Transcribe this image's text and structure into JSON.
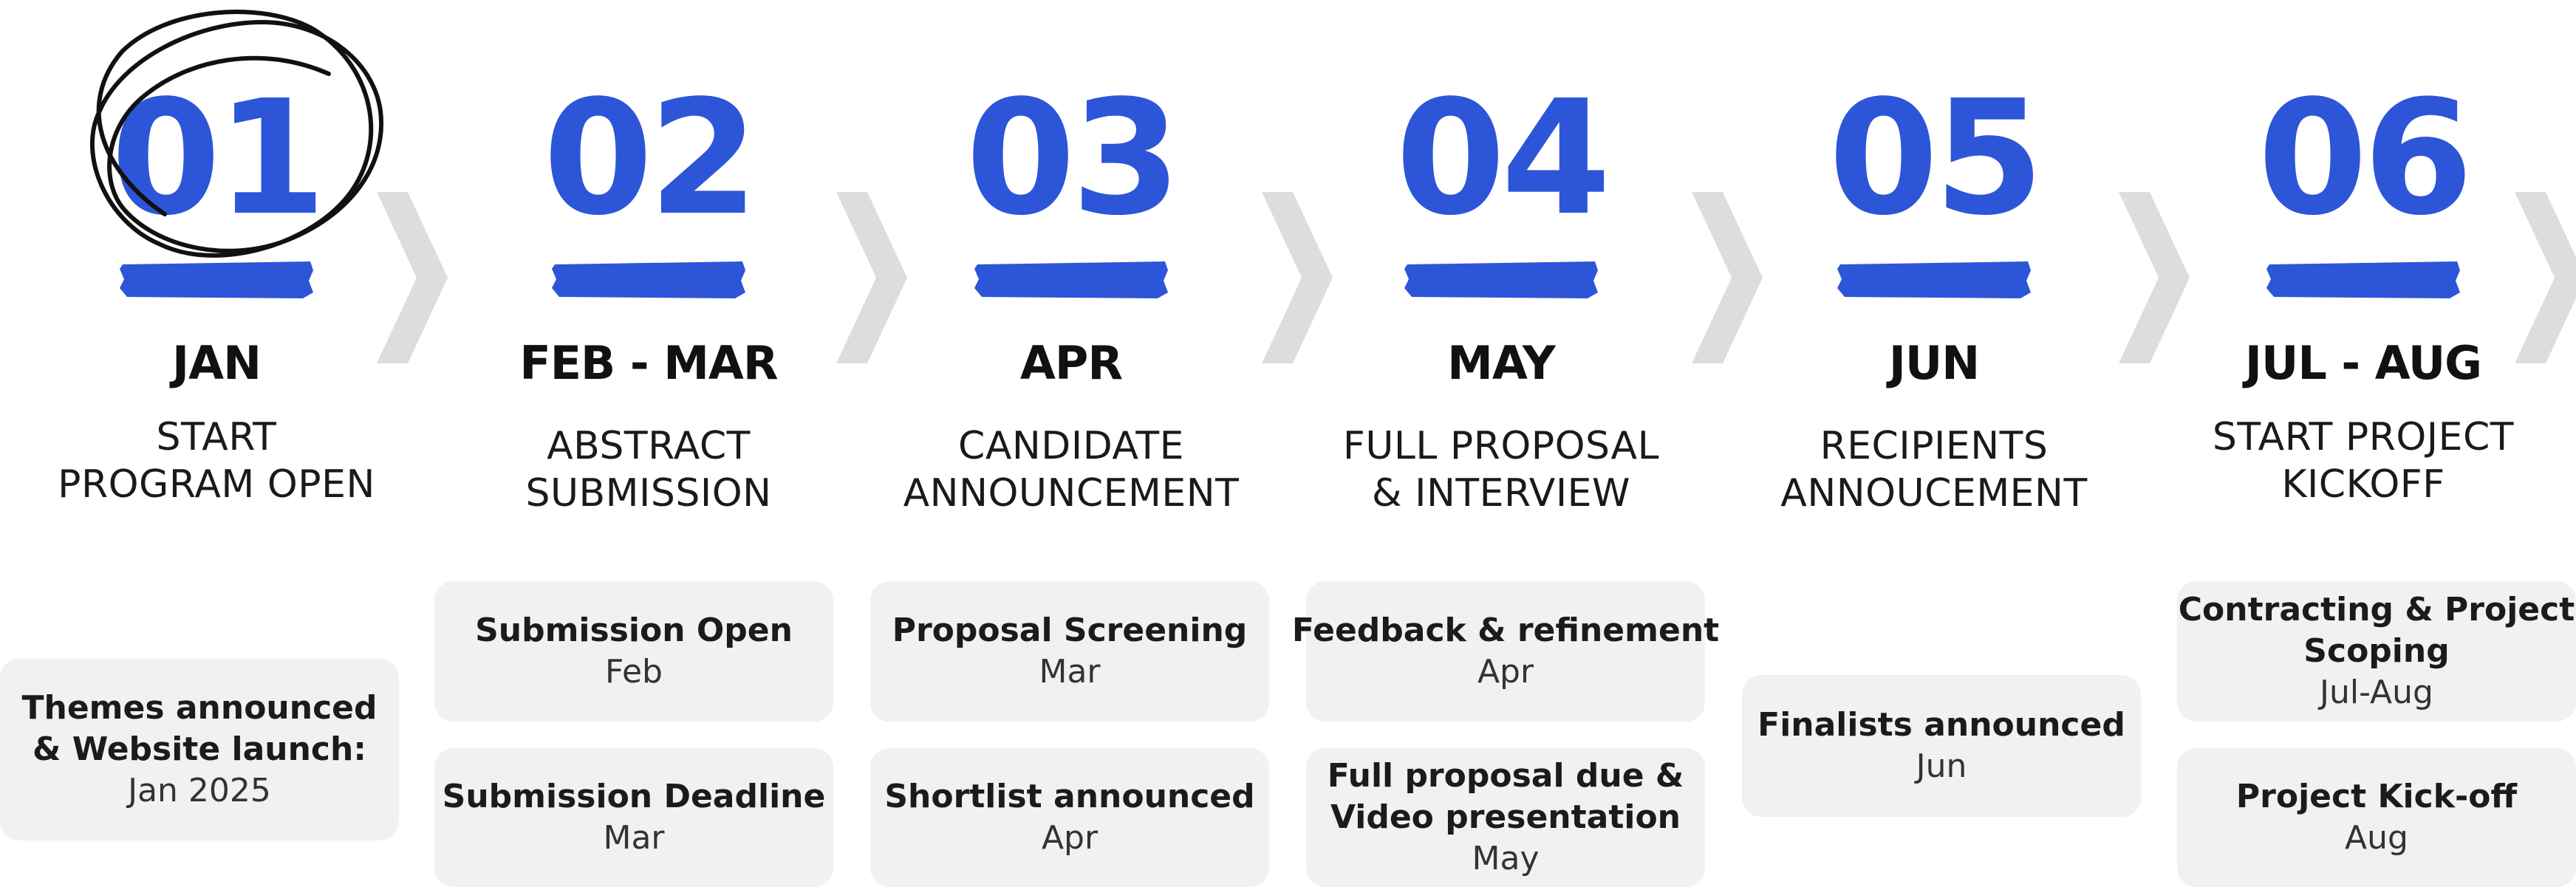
{
  "steps": [
    {
      "number": "01",
      "month": "JAN",
      "desc": [
        "START",
        "PROGRAM OPEN"
      ]
    },
    {
      "number": "02",
      "month": "FEB - MAR",
      "desc": [
        "ABSTRACT",
        "SUBMISSION"
      ]
    },
    {
      "number": "03",
      "month": "APR",
      "desc": [
        "CANDIDATE",
        "ANNOUNCEMENT"
      ]
    },
    {
      "number": "04",
      "month": "MAY",
      "desc": [
        "FULL PROPOSAL",
        "& INTERVIEW"
      ]
    },
    {
      "number": "05",
      "month": "JUN",
      "desc": [
        "RECIPIENTS",
        "ANNOUCEMENT"
      ]
    },
    {
      "number": "06",
      "month": "JUL - AUG",
      "desc": [
        "START PROJECT",
        "KICKOFF"
      ]
    }
  ],
  "cards": [
    [
      {
        "title": [
          "Themes announced",
          "& Website launch:"
        ],
        "sub": "Jan 2025"
      }
    ],
    [
      {
        "title": [
          "Submission Open"
        ],
        "sub": "Feb"
      },
      {
        "title": [
          "Submission Deadline"
        ],
        "sub": "Mar"
      }
    ],
    [
      {
        "title": [
          "Proposal Screening"
        ],
        "sub": "Mar"
      },
      {
        "title": [
          "Shortlist announced"
        ],
        "sub": "Apr"
      }
    ],
    [
      {
        "title": [
          "Feedback & refinement"
        ],
        "sub": "Apr"
      },
      {
        "title": [
          "Full proposal due &",
          "Video presentation"
        ],
        "sub": "May"
      }
    ],
    [
      {
        "title": [
          "Finalists announced"
        ],
        "sub": "Jun"
      }
    ],
    [
      {
        "title": [
          "Contracting & Project",
          "Scoping"
        ],
        "sub": "Jul-Aug"
      },
      {
        "title": [
          "Project Kick-off"
        ],
        "sub": "Aug"
      }
    ]
  ],
  "colors": {
    "accent": "#2d55d8",
    "chevron": "#dddddd",
    "card": "#f1f1f1",
    "text": "#111111"
  }
}
